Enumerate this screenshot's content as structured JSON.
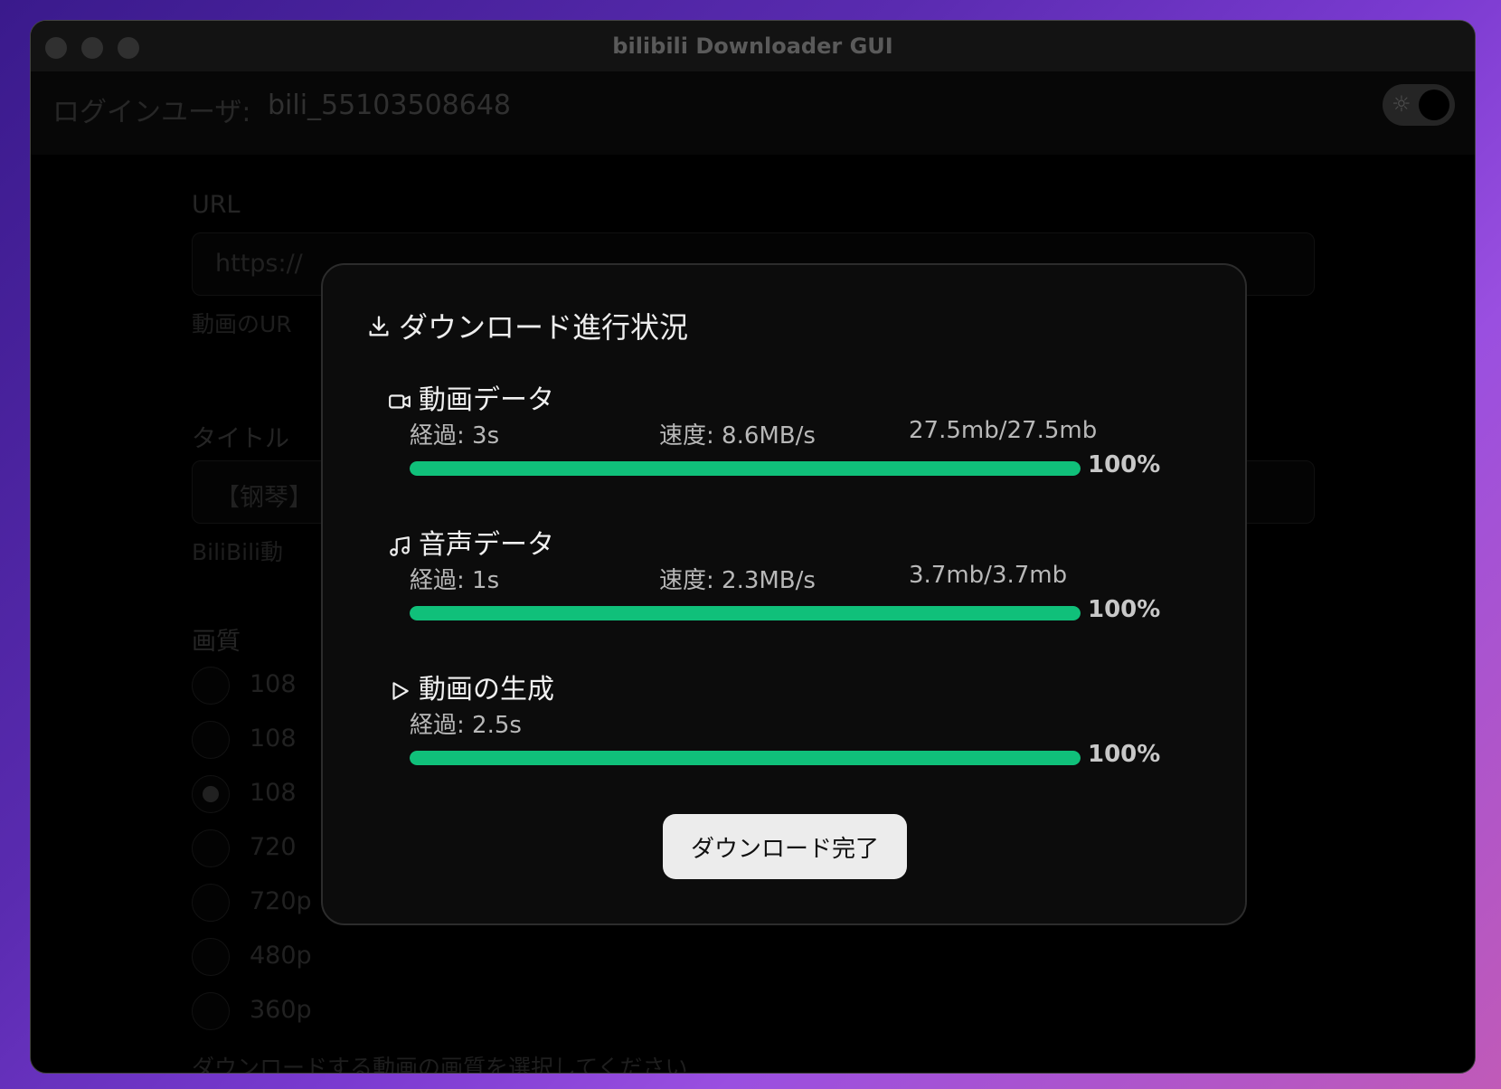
{
  "window": {
    "title": "bilibili Downloader GUI"
  },
  "userbar": {
    "label": "ログインユーザ:",
    "username": "bili_55103508648"
  },
  "form": {
    "url_label": "URL",
    "url_value": "https://",
    "url_hint": "動画のUR",
    "title_label": "タイトル",
    "title_value": "【钢琴】",
    "title_hint": "BiliBili動",
    "quality_label": "画質",
    "quality_options": [
      "108",
      "108",
      "108",
      "720",
      "720p",
      "480p",
      "360p"
    ],
    "quality_selected_index": 2,
    "quality_hint": "ダウンロードする動画の画質を選択してください"
  },
  "modal": {
    "title": "ダウンロード進行状況",
    "sections": [
      {
        "icon": "video-camera-icon",
        "label": "動画データ",
        "elapsed": "経過: 3s",
        "speed": "速度: 8.6MB/s",
        "size": "27.5mb/27.5mb",
        "progress": 100,
        "progress_label": "100%"
      },
      {
        "icon": "music-note-icon",
        "label": "音声データ",
        "elapsed": "経過: 1s",
        "speed": "速度: 2.3MB/s",
        "size": "3.7mb/3.7mb",
        "progress": 100,
        "progress_label": "100%"
      },
      {
        "icon": "play-icon",
        "label": "動画の生成",
        "elapsed": "経過: 2.5s",
        "progress": 100,
        "progress_label": "100%"
      }
    ],
    "done_button": "ダウンロード完了"
  },
  "colors": {
    "progress": "#10c07a",
    "modal_bg": "#0c0c0c"
  }
}
